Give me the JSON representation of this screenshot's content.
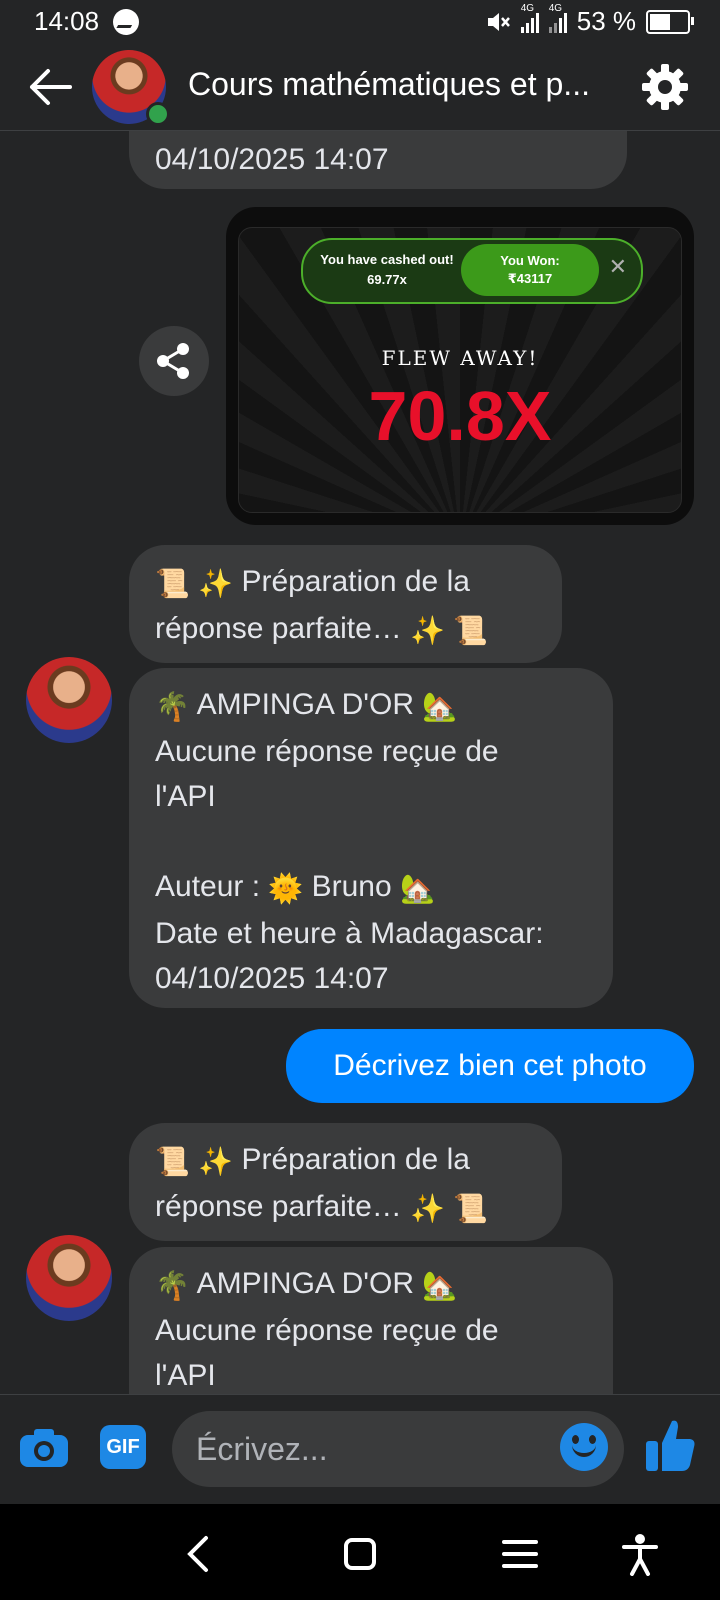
{
  "status_bar": {
    "time": "14:08",
    "net1": "4G",
    "net2": "4G",
    "battery": "53 %"
  },
  "header": {
    "title": "Cours mathématiques et p..."
  },
  "messages": {
    "m0": {
      "l1": "04/10/2025 14:07"
    },
    "game": {
      "cashed_out": "You have cashed out!",
      "cashed_mult": "69.77x",
      "won_label": "You Won:",
      "won_amount": "₹43117",
      "close": "✕",
      "flew": "FLEW AWAY!",
      "mult": "70.8X"
    },
    "m1": {
      "l1": "Préparation de la",
      "l2": "réponse parfaite…"
    },
    "m2": {
      "l1": "AMPINGA D'OR",
      "l2": "Aucune réponse reçue de",
      "l3": "l'API",
      "l4a": "Auteur :",
      "l4b": "Bruno",
      "l5": "Date et heure à Madagascar:",
      "l6": "04/10/2025 14:07"
    },
    "m3": {
      "l1": "Décrivez bien cet photo"
    },
    "m4": {
      "l1": "Préparation de la",
      "l2": "réponse parfaite…"
    },
    "m5": {
      "l1": "AMPINGA D'OR",
      "l2": "Aucune réponse reçue de",
      "l3": "l'API"
    }
  },
  "composer": {
    "gif": "GIF",
    "placeholder": "Écrivez..."
  },
  "icons": {
    "scroll": "📜",
    "sparkles": "✨",
    "palm": "🌴",
    "house": "🏡",
    "sun": "🌞"
  },
  "colors": {
    "accent": "#0084ff",
    "online": "#31a24c",
    "multiplier": "#e8102a"
  }
}
